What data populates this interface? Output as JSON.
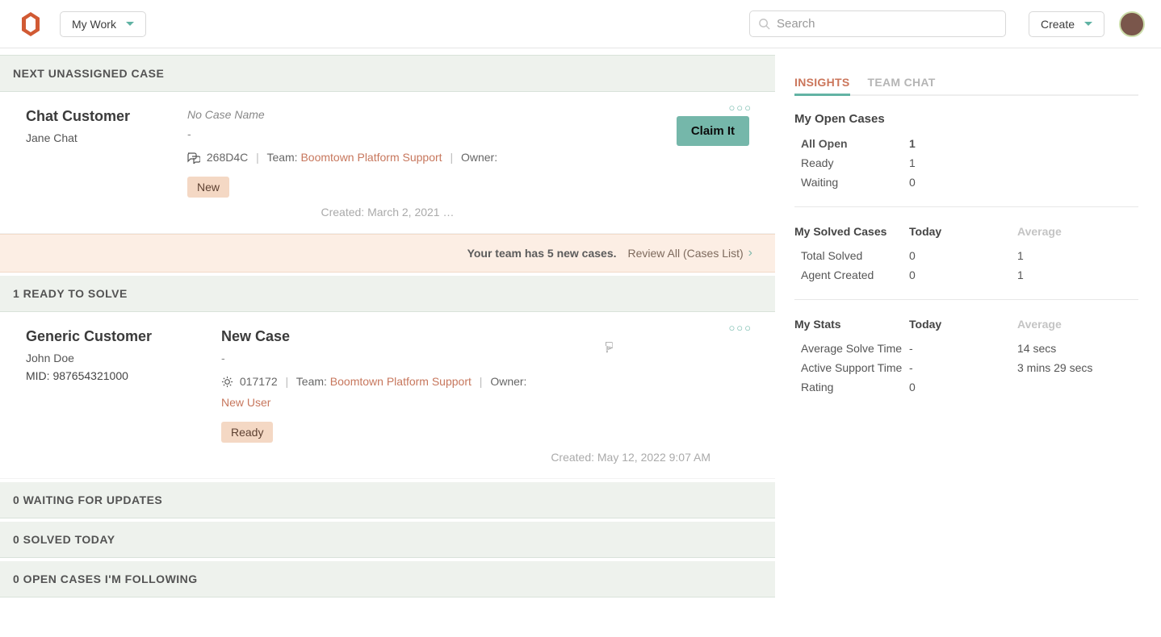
{
  "header": {
    "navLabel": "My Work",
    "searchPlaceholder": "Search",
    "createLabel": "Create"
  },
  "sections": {
    "unassigned": "NEXT UNASSIGNED CASE",
    "ready": "1 READY TO SOLVE",
    "waiting": "0 WAITING FOR UPDATES",
    "solved": "0 SOLVED TODAY",
    "following": "0 OPEN CASES I'M FOLLOWING"
  },
  "unassignedCase": {
    "customer": "Chat Customer",
    "contact": "Jane Chat",
    "caseName": "No Case Name",
    "dash": "-",
    "id": "268D4C",
    "teamLabel": "Team:",
    "team": "Boomtown Platform Support",
    "ownerLabel": "Owner:",
    "status": "New",
    "claimLabel": "Claim It",
    "created": "Created: March 2, 2021 …"
  },
  "banner": {
    "message": "Your team has 5 new cases.",
    "review": "Review All (Cases List)"
  },
  "readyCase": {
    "customer": "Generic Customer",
    "contact": "John Doe",
    "midLabel": "MID:",
    "mid": "987654321000",
    "caseName": "New Case",
    "dash": "-",
    "id": "017172",
    "teamLabel": "Team:",
    "team": "Boomtown Platform Support",
    "ownerLabel": "Owner:",
    "owner": "New User",
    "status": "Ready",
    "created": "Created: May 12, 2022 9:07 AM"
  },
  "tabs": {
    "insights": "INSIGHTS",
    "teamChat": "TEAM CHAT"
  },
  "insights": {
    "openCases": {
      "heading": "My Open Cases",
      "rows": [
        {
          "k": "All Open",
          "v": "1"
        },
        {
          "k": "Ready",
          "v": "1"
        },
        {
          "k": "Waiting",
          "v": "0"
        }
      ]
    },
    "solved": {
      "heading": "My Solved Cases",
      "todayLabel": "Today",
      "averageLabel": "Average",
      "rows": [
        {
          "k": "Total Solved",
          "today": "0",
          "avg": "1"
        },
        {
          "k": "Agent Created",
          "today": "0",
          "avg": "1"
        }
      ]
    },
    "stats": {
      "heading": "My Stats",
      "todayLabel": "Today",
      "averageLabel": "Average",
      "rows": [
        {
          "k": "Average Solve Time",
          "today": "-",
          "avg": "14 secs"
        },
        {
          "k": "Active Support Time",
          "today": "-",
          "avg": "3 mins 29 secs"
        },
        {
          "k": "Rating",
          "today": "0",
          "avg": ""
        }
      ]
    }
  }
}
